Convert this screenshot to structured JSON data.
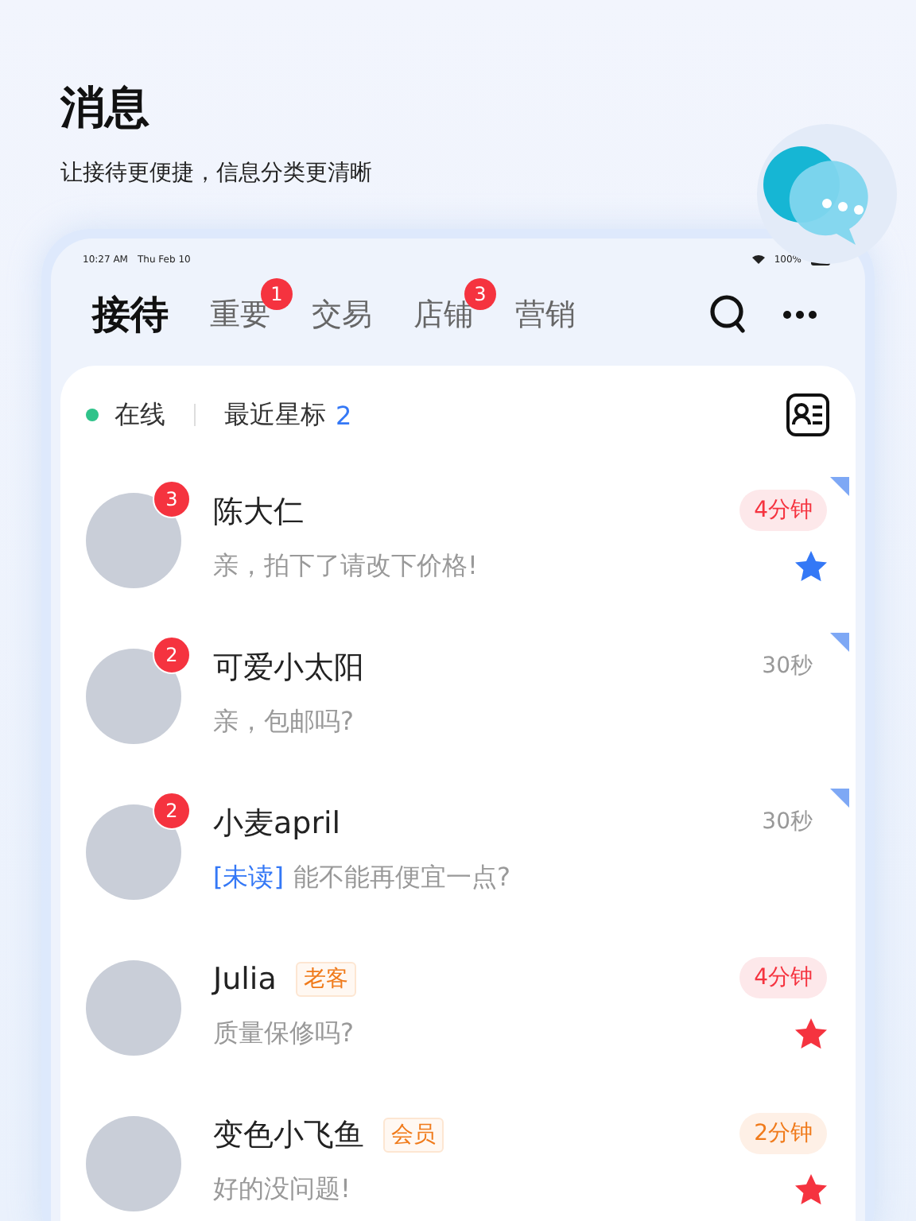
{
  "header": {
    "title": "消息",
    "subtitle": "让接待更便捷，信息分类更清晰"
  },
  "status_bar": {
    "time": "10:27 AM",
    "date": "Thu Feb 10",
    "battery": "100%"
  },
  "tabs": [
    {
      "label": "接待",
      "selected": true
    },
    {
      "label": "重要",
      "selected": false,
      "badge": "1"
    },
    {
      "label": "交易",
      "selected": false
    },
    {
      "label": "店铺",
      "selected": false,
      "badge": "3"
    },
    {
      "label": "营销",
      "selected": false
    }
  ],
  "filter_bar": {
    "status": "在线",
    "online": true,
    "starred_label": "最近星标",
    "starred_count": "2"
  },
  "conversations": [
    {
      "name": "陈大仁",
      "badge": "3",
      "time": "4分钟",
      "kind": "alert",
      "message": "亲，拍下了请改下价格!",
      "star": {
        "color": "#3478f6"
      },
      "pinned": true
    },
    {
      "name": "可爱小太阳",
      "badge": "2",
      "time": "30秒",
      "kind": "plain",
      "message": "亲，包邮吗?",
      "pinned": true
    },
    {
      "name": "小麦april",
      "badge": "2",
      "time": "30秒",
      "kind": "plain",
      "prefix": "[未读]",
      "message": "能不能再便宜一点?",
      "pinned": true
    },
    {
      "name": "Julia",
      "tag": "老客",
      "time": "4分钟",
      "kind": "alert",
      "message": "质量保修吗?",
      "star": {
        "color": "#f5333f"
      },
      "pinned": false
    },
    {
      "name": "变色小飞鱼",
      "tag": "会员",
      "time": "2分钟",
      "kind": "warn",
      "message": "好的没问题!",
      "star": {
        "color": "#f5333f"
      },
      "pinned": false
    }
  ]
}
